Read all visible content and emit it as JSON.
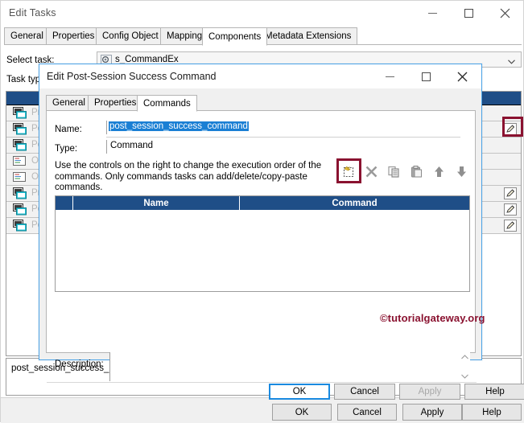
{
  "main_window": {
    "title": "Edit Tasks",
    "window_controls": {
      "minimize": "minimize-icon",
      "maximize": "maximize-icon",
      "close": "close-icon"
    },
    "tabs": [
      {
        "label": "General",
        "active": false
      },
      {
        "label": "Properties",
        "active": false
      },
      {
        "label": "Config Object",
        "active": false
      },
      {
        "label": "Mapping",
        "active": false
      },
      {
        "label": "Components",
        "active": true
      },
      {
        "label": "Metadata Extensions",
        "active": false
      }
    ],
    "select_task_label": "Select task:",
    "task_combo_value": "s_CommandEx",
    "task_type_label": "Task typ",
    "list_rows": [
      {
        "label": "Pre",
        "icon": "session-icon",
        "pencil": false
      },
      {
        "label": "Po",
        "icon": "session-icon",
        "pencil": true
      },
      {
        "label": "Po",
        "icon": "session-icon",
        "pencil": false
      },
      {
        "label": "On",
        "icon": "email-icon",
        "pencil": false
      },
      {
        "label": "On",
        "icon": "email-icon",
        "pencil": false
      },
      {
        "label": "Pre",
        "icon": "session-icon",
        "pencil": true
      },
      {
        "label": "Po",
        "icon": "session-icon",
        "pencil": true
      },
      {
        "label": "Po",
        "icon": "session-icon",
        "pencil": true
      }
    ],
    "bottom_textbox_value": "post_session_success_command",
    "footer_buttons": [
      {
        "label": "OK"
      },
      {
        "label": "Cancel"
      },
      {
        "label": "Apply"
      },
      {
        "label": "Help"
      }
    ]
  },
  "dialog": {
    "title": "Edit Post-Session Success Command",
    "window_controls": {
      "minimize": "minimize-icon",
      "maximize": "maximize-icon",
      "close": "close-icon"
    },
    "tabs": [
      {
        "label": "General",
        "active": false
      },
      {
        "label": "Properties",
        "active": false
      },
      {
        "label": "Commands",
        "active": true
      }
    ],
    "name_label": "Name:",
    "name_value": "post_session_success_command",
    "type_label": "Type:",
    "type_value": "Command",
    "instructions": "Use the controls on the right to change the execution order of the commands.  Only commands tasks can add/delete/copy-paste commands.",
    "toolbar": [
      {
        "name": "new-command-button",
        "icon": "new-icon",
        "highlighted": true,
        "enabled": true
      },
      {
        "name": "delete-command-button",
        "icon": "delete-x-icon",
        "highlighted": false,
        "enabled": false
      },
      {
        "name": "copy-command-button",
        "icon": "copy-icon",
        "highlighted": false,
        "enabled": false
      },
      {
        "name": "paste-command-button",
        "icon": "paste-icon",
        "highlighted": false,
        "enabled": false
      },
      {
        "name": "move-up-button",
        "icon": "arrow-up-icon",
        "highlighted": false,
        "enabled": true
      },
      {
        "name": "move-down-button",
        "icon": "arrow-down-icon",
        "highlighted": false,
        "enabled": true
      }
    ],
    "table": {
      "columns": [
        "",
        "Name",
        "Command"
      ],
      "rows": []
    },
    "watermark": "©tutorialgateway.org",
    "description_label": "Description:",
    "description_value": "",
    "buttons": [
      {
        "label": "OK",
        "state": "focused"
      },
      {
        "label": "Cancel",
        "state": "normal"
      },
      {
        "label": "Apply",
        "state": "disabled"
      },
      {
        "label": "Help",
        "state": "normal"
      }
    ]
  },
  "colors": {
    "accent_blue": "#1a7fd4",
    "dialog_border": "#4aa3e8",
    "header_navy": "#1f4e87",
    "highlight_red": "#8a1230",
    "watermark_red": "#8a1230"
  }
}
